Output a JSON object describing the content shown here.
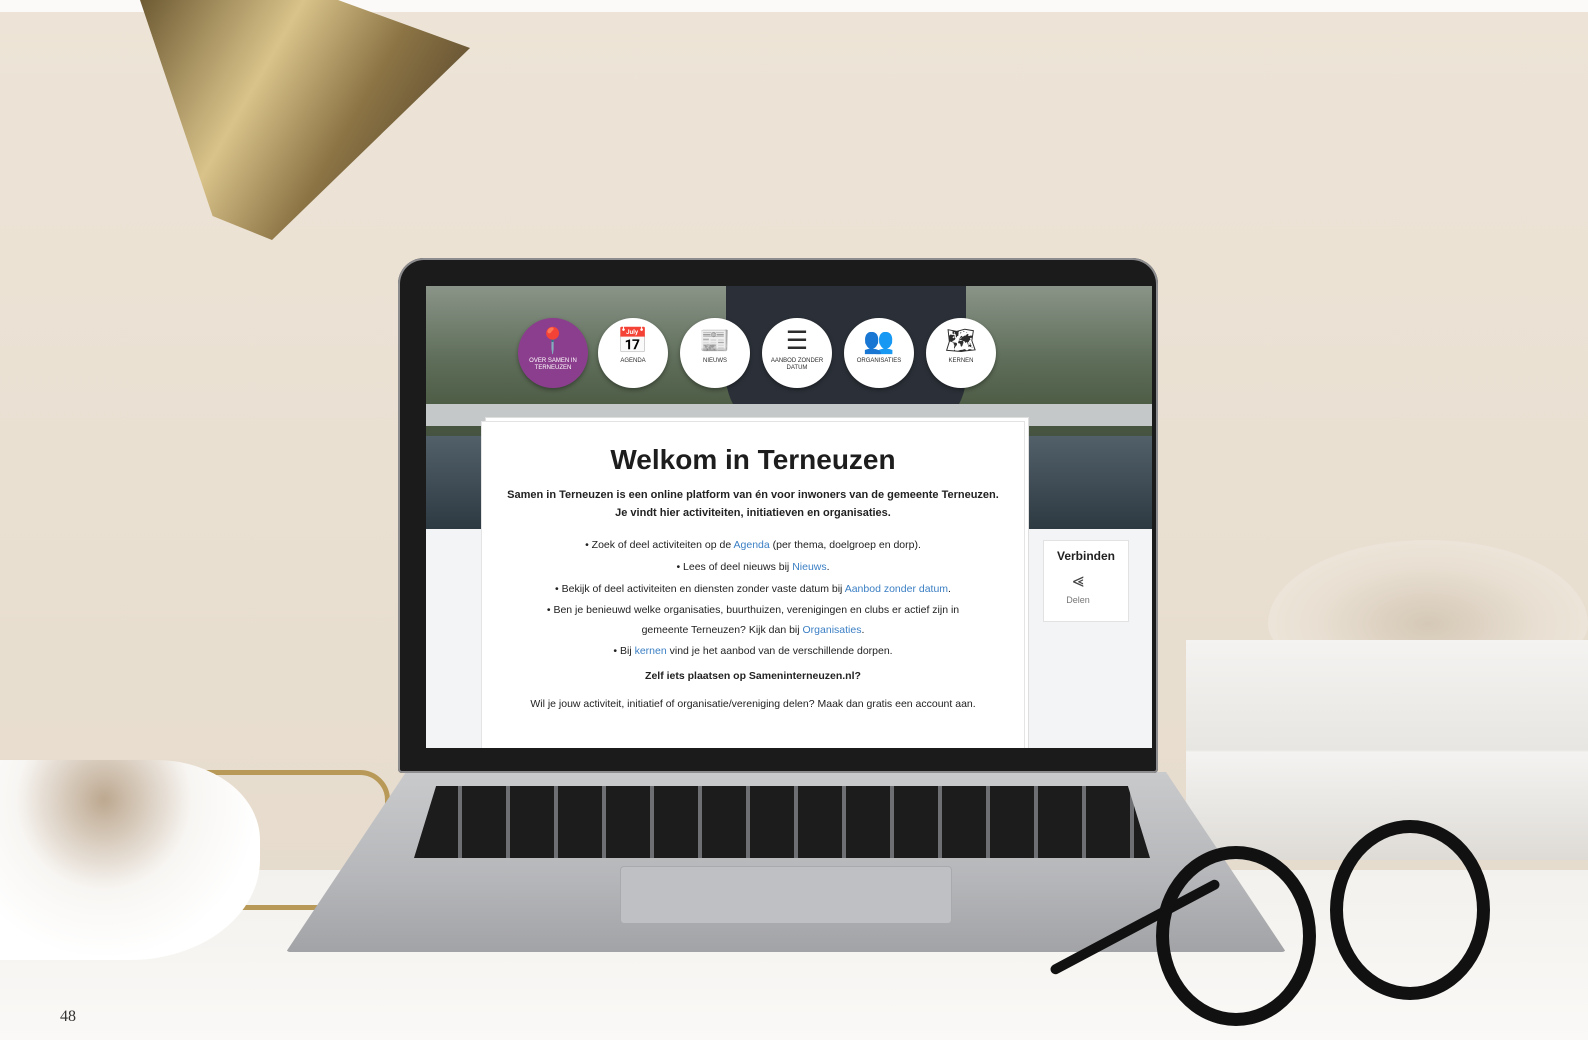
{
  "nav": {
    "items": [
      {
        "label": "OVER SAMEN IN TERNEUZEN",
        "icon": "map-pin-icon",
        "active": true
      },
      {
        "label": "AGENDA",
        "icon": "calendar-icon",
        "active": false
      },
      {
        "label": "NIEUWS",
        "icon": "newspaper-icon",
        "active": false
      },
      {
        "label": "AANBOD ZONDER DATUM",
        "icon": "list-icon",
        "active": false
      },
      {
        "label": "ORGANISATIES",
        "icon": "group-icon",
        "active": false
      },
      {
        "label": "KERNEN",
        "icon": "map-icon",
        "active": false
      }
    ]
  },
  "content": {
    "title": "Welkom in Terneuzen",
    "intro_line1": "Samen in Terneuzen is een online platform van én voor inwoners van de gemeente Terneuzen.",
    "intro_line2": "Je vindt hier activiteiten, initiatieven en organisaties.",
    "bullets": [
      {
        "before": "Zoek of deel activiteiten op de ",
        "link": "Agenda",
        "after": " (per thema, doelgroep en dorp)."
      },
      {
        "before": "Lees of deel nieuws bij ",
        "link": "Nieuws",
        "after": "."
      },
      {
        "before": "Bekijk of deel activiteiten en diensten zonder vaste datum bij ",
        "link": "Aanbod zonder datum",
        "after": "."
      },
      {
        "before": "Ben je benieuwd welke organisaties, buurthuizen, verenigingen en clubs er actief zijn in gemeente Terneuzen? Kijk dan bij ",
        "link": "Organisaties",
        "after": "."
      },
      {
        "before": "Bij ",
        "link": "kernen",
        "after": " vind je het aanbod van de verschillende dorpen."
      }
    ],
    "cta": "Zelf iets plaatsen op Sameninterneuzen.nl?",
    "closing": "Wil je jouw activiteit, initiatief of organisatie/vereniging delen? Maak dan gratis een account aan."
  },
  "share": {
    "title": "Verbinden",
    "label": "Delen",
    "icon": "share-icon"
  },
  "page_number": "48",
  "colors": {
    "accent": "#8c3e8e",
    "link": "#3b7fc4"
  }
}
